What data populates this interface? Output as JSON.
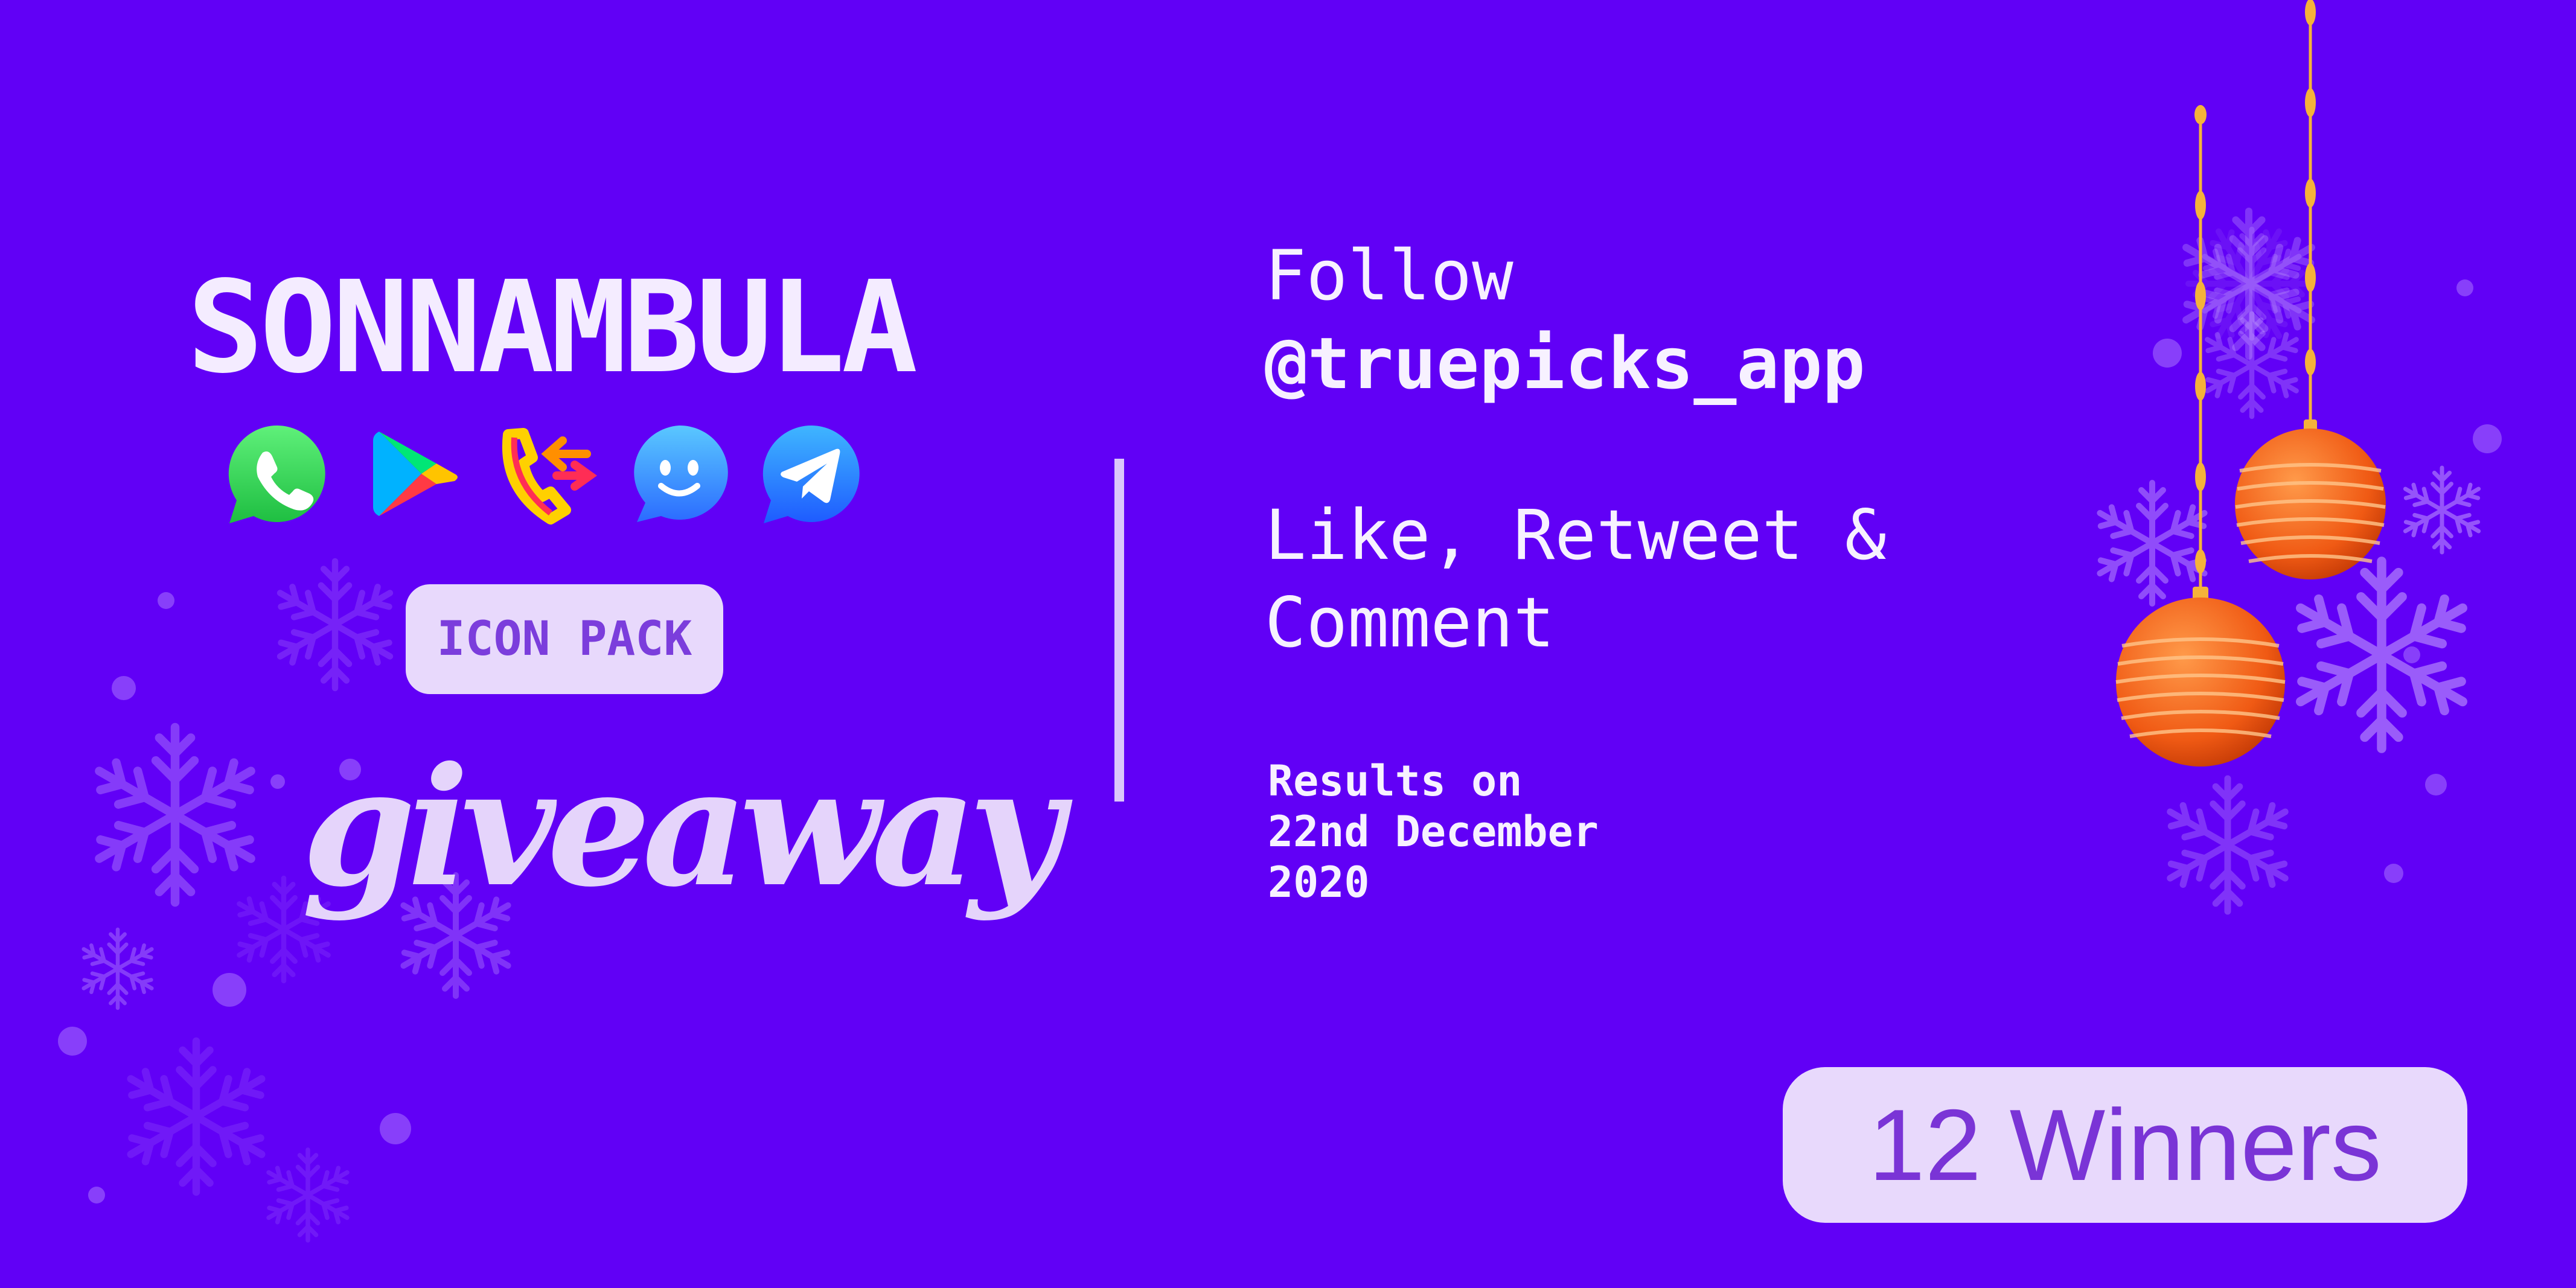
{
  "title": "SONNAMBULA",
  "app_icons": [
    {
      "name": "whatsapp-icon",
      "color": "#2fcf4f"
    },
    {
      "name": "google-play-icon",
      "color": "#00c853"
    },
    {
      "name": "phone-dialer-icon",
      "color": "#ff6d00"
    },
    {
      "name": "chat-smile-icon",
      "color": "#3aa0ff"
    },
    {
      "name": "telegram-icon",
      "color": "#2f8bff"
    }
  ],
  "badge": "ICON PACK",
  "subtitle": "giveaway",
  "instructions": {
    "follow": "Follow",
    "handle": "@truepicks_app",
    "like_line1": "Like, Retweet &",
    "like_line2": "Comment",
    "results_line1": "Results on",
    "results_line2": "22nd December",
    "results_line3": "2020"
  },
  "winners": "12 Winners",
  "colors": {
    "background": "#6100f6",
    "badge_bg": "#e8d9fc",
    "accent_text": "#7a34d6",
    "ornament": "#ff6a1e",
    "gold_string": "#f5b23a"
  }
}
